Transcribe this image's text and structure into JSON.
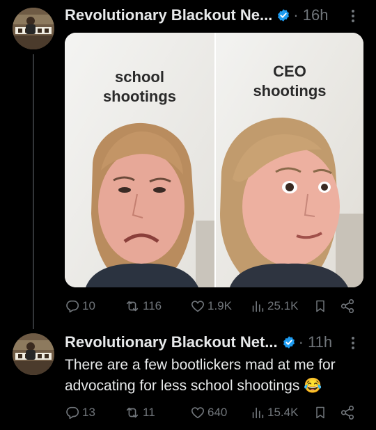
{
  "tweets": [
    {
      "display_name": "Revolutionary Blackout Ne...",
      "time": "· 16h",
      "media": {
        "left_caption": "school\nshootings",
        "right_caption": "CEO\nshootings"
      },
      "stats": {
        "replies": "10",
        "reposts": "116",
        "likes": "1.9K",
        "views": "25.1K"
      }
    },
    {
      "display_name": "Revolutionary Blackout Net...",
      "time": "· 11h",
      "text": "There are a few bootlickers mad at me for advocating for less school shootings 😂",
      "stats": {
        "replies": "13",
        "reposts": "11",
        "likes": "640",
        "views": "15.4K"
      }
    }
  ],
  "icons": [
    "verified-badge-icon",
    "more-icon",
    "reply-icon",
    "repost-icon",
    "like-icon",
    "views-icon",
    "bookmark-icon",
    "share-icon"
  ],
  "colors": {
    "background": "#000000",
    "text": "#e7e9ea",
    "muted": "#71767b",
    "verified": "#1d9bf0"
  }
}
